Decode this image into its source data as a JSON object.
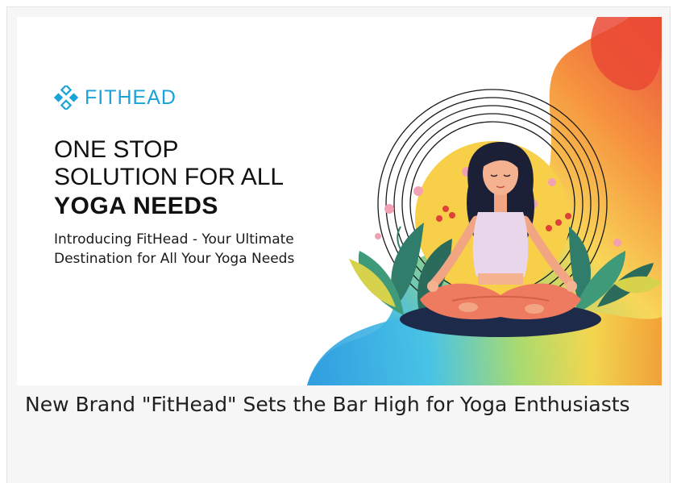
{
  "card": {
    "logo_text": "FITHEAD",
    "headline_line1": "ONE STOP",
    "headline_line2": "SOLUTION FOR ALL",
    "headline_line3": "YOGA NEEDS",
    "subtext": "Introducing FitHead - Your Ultimate Destination for All Your Yoga Needs",
    "title": "New Brand \"FitHead\" Sets the Bar High for Yoga Enthusiasts"
  },
  "colors": {
    "brand": "#1aa3d9",
    "headline": "#111111",
    "caption": "#1f1f1f",
    "sun": "#f8cf48"
  },
  "icons": {
    "logo": "diamond-cluster-icon"
  }
}
